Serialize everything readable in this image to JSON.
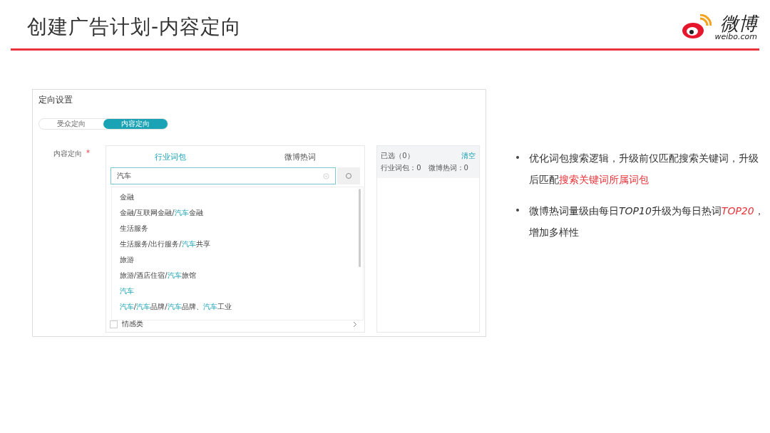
{
  "slide": {
    "title": "创建广告计划-内容定向"
  },
  "logo": {
    "name": "微博",
    "domain": "weibo.com"
  },
  "panel": {
    "title": "定向设置",
    "mode_tabs": [
      {
        "label": "受众定向",
        "selected": false
      },
      {
        "label": "内容定向",
        "selected": true
      }
    ],
    "field_label": "内容定向",
    "required_mark": "*",
    "word_tabs": [
      {
        "label": "行业词包",
        "selected": true
      },
      {
        "label": "微博热词",
        "selected": false
      }
    ],
    "search": {
      "value": "汽车"
    },
    "results": [
      [
        {
          "text": "金融",
          "match": false
        }
      ],
      [
        {
          "text": "金融/互联网金融/",
          "match": false
        },
        {
          "text": "汽车",
          "match": true
        },
        {
          "text": "金融",
          "match": false
        }
      ],
      [
        {
          "text": "生活服务",
          "match": false
        }
      ],
      [
        {
          "text": "生活服务/出行服务/",
          "match": false
        },
        {
          "text": "汽车",
          "match": true
        },
        {
          "text": "共享",
          "match": false
        }
      ],
      [
        {
          "text": "旅游",
          "match": false
        }
      ],
      [
        {
          "text": "旅游/酒店住宿/",
          "match": false
        },
        {
          "text": "汽车",
          "match": true
        },
        {
          "text": "旅馆",
          "match": false
        }
      ],
      [
        {
          "text": "汽车",
          "match": true
        }
      ],
      [
        {
          "text": "汽车",
          "match": true
        },
        {
          "text": "/",
          "match": false
        },
        {
          "text": "汽车",
          "match": true
        },
        {
          "text": "品牌/",
          "match": false
        },
        {
          "text": "汽车",
          "match": true
        },
        {
          "text": "品牌、",
          "match": false
        },
        {
          "text": "汽车",
          "match": true
        },
        {
          "text": "工业",
          "match": false
        }
      ]
    ],
    "bottom_item": {
      "label": "情感类",
      "checked": false
    },
    "selected_box": {
      "title": "已选（0）",
      "clear": "清空",
      "counts": "行业词包：0　微博热词：0"
    }
  },
  "bullets": [
    [
      {
        "text": "优化词包搜索逻辑，升级前仅匹配搜索关键词，升级后匹配",
        "red": false,
        "latin": false
      },
      {
        "text": "搜索关键词所属词包",
        "red": true,
        "latin": false
      }
    ],
    [
      {
        "text": "微博热词量级由每日",
        "red": false,
        "latin": false
      },
      {
        "text": "TOP10",
        "red": false,
        "latin": true
      },
      {
        "text": "升级为每日热词",
        "red": false,
        "latin": false
      },
      {
        "text": "TOP20",
        "red": true,
        "latin": true
      },
      {
        "text": "，增加多样性",
        "red": false,
        "latin": false
      }
    ]
  ]
}
